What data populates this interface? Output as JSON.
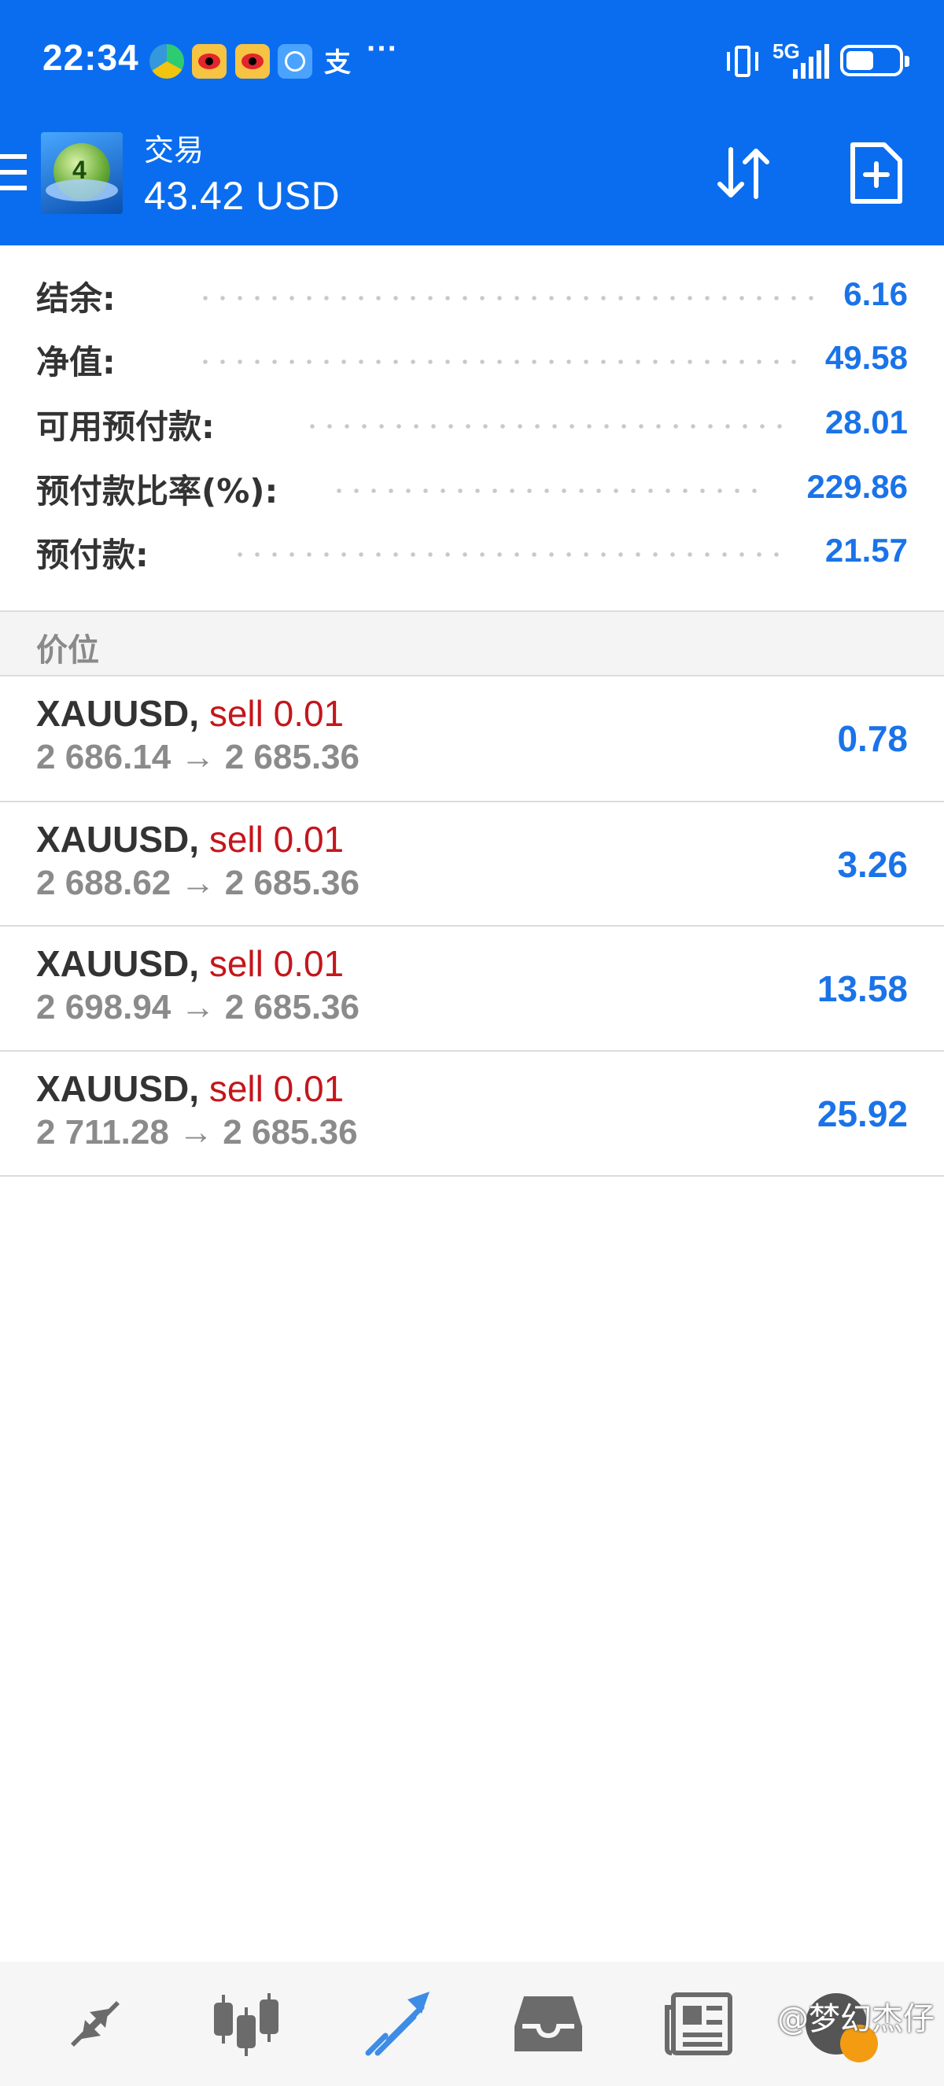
{
  "status_bar": {
    "time": "22:34",
    "network": "5G",
    "more": "···",
    "alipay_glyph": "支"
  },
  "header": {
    "title": "交易",
    "subtitle": "43.42 USD",
    "icons": [
      "menu-icon",
      "sort-icon",
      "new-order-icon"
    ]
  },
  "account": [
    {
      "label": "结余:",
      "value": "6.16"
    },
    {
      "label": "净值:",
      "value": "49.58"
    },
    {
      "label": "可用预付款:",
      "value": "28.01"
    },
    {
      "label": "预付款比率(%):",
      "value": "229.86"
    },
    {
      "label": "预付款:",
      "value": "21.57"
    }
  ],
  "positions_header": "价位",
  "positions": [
    {
      "symbol": "XAUUSD,",
      "side": "sell 0.01",
      "prices": "2 686.14 → 2 685.36",
      "profit": "0.78"
    },
    {
      "symbol": "XAUUSD,",
      "side": "sell 0.01",
      "prices": "2 688.62 → 2 685.36",
      "profit": "3.26"
    },
    {
      "symbol": "XAUUSD,",
      "side": "sell 0.01",
      "prices": "2 698.94 → 2 685.36",
      "profit": "13.58"
    },
    {
      "symbol": "XAUUSD,",
      "side": "sell 0.01",
      "prices": "2 711.28 → 2 685.36",
      "profit": "25.92"
    }
  ],
  "bottom_nav": [
    "quotes-icon",
    "chart-icon",
    "trade-icon",
    "history-icon",
    "news-icon"
  ],
  "watermark": "@梦幻杰仔",
  "colors": {
    "header_bg": "#0a6df0",
    "value_blue": "#1a73e8",
    "sell_red": "#c4161c",
    "active_nav": "#3d8ce6",
    "inactive_nav": "#6b6b6b"
  }
}
